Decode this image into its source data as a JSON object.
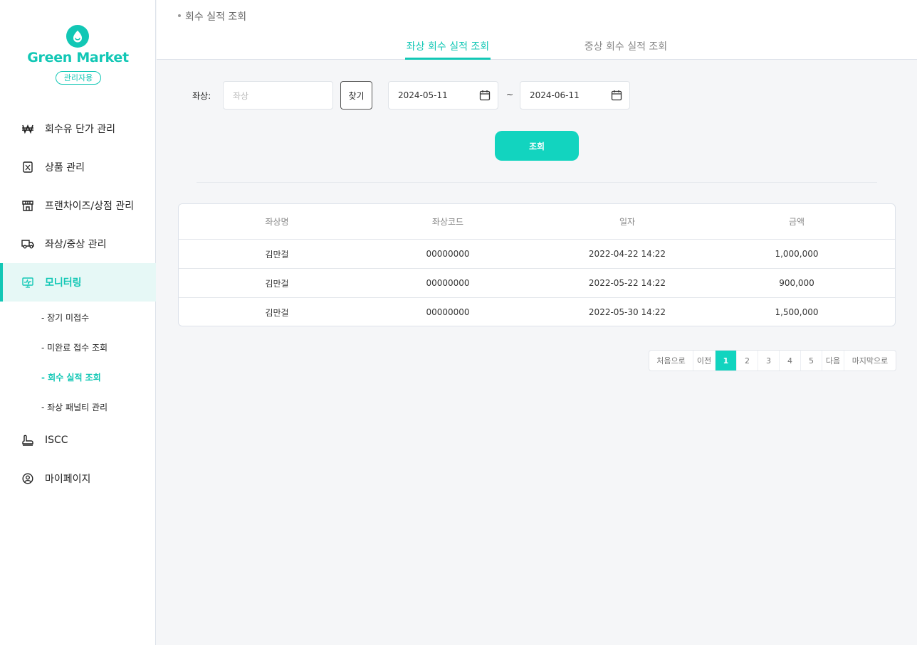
{
  "brand": {
    "name": "Green Market",
    "badge": "관리자용"
  },
  "nav": {
    "items": [
      {
        "label": "회수유 단가 관리",
        "icon": "won-icon"
      },
      {
        "label": "상품 관리",
        "icon": "product-icon"
      },
      {
        "label": "프랜차이즈/상점 관리",
        "icon": "store-icon"
      },
      {
        "label": "좌상/중상 관리",
        "icon": "truck-icon"
      },
      {
        "label": "모니터링",
        "icon": "monitor-icon"
      },
      {
        "label": "ISCC",
        "icon": "stamp-icon"
      },
      {
        "label": "마이페이지",
        "icon": "user-circle-icon"
      }
    ],
    "sub_items": [
      {
        "label": "- 장기 미접수"
      },
      {
        "label": "- 미완료 접수 조회"
      },
      {
        "label": "- 회수 실적 조회"
      },
      {
        "label": "- 좌상 패널티 관리"
      }
    ]
  },
  "header": {
    "breadcrumb": "회수 실적 조회",
    "tabs": [
      {
        "label": "좌상 회수 실적 조회"
      },
      {
        "label": "중상 회수 실적 조회"
      }
    ]
  },
  "search": {
    "dealer_label": "좌상:",
    "dealer_placeholder": "좌상",
    "find_label": "찾기",
    "start_date": "2024-05-11",
    "end_date": "2024-06-11",
    "range_separator": "~",
    "query_label": "조회"
  },
  "table": {
    "headers": [
      "좌상명",
      "좌상코드",
      "일자",
      "금액"
    ],
    "rows": [
      [
        "김만걸",
        "00000000",
        "2022-04-22 14:22",
        "1,000,000"
      ],
      [
        "김만걸",
        "00000000",
        "2022-05-22 14:22",
        "900,000"
      ],
      [
        "김만걸",
        "00000000",
        "2022-05-30 14:22",
        "1,500,000"
      ]
    ]
  },
  "pagination": {
    "first": "처음으로",
    "prev": "이전",
    "pages": [
      "1",
      "2",
      "3",
      "4",
      "5"
    ],
    "current": "1",
    "next": "다음",
    "last": "마지막으로"
  },
  "colors": {
    "accent": "#12c7b5",
    "button": "#12d4bf",
    "active_bg": "#e6f8f6"
  }
}
